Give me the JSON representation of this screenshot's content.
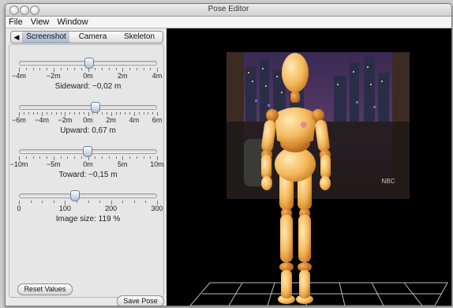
{
  "window": {
    "title": "Pose Editor"
  },
  "menu": {
    "items": [
      "File",
      "View",
      "Window"
    ]
  },
  "tabs": {
    "arrow": "◀",
    "items": [
      "Screenshot",
      "Camera",
      "Skeleton"
    ],
    "selected": "Screenshot"
  },
  "sliders": [
    {
      "ticks": [
        "−4m",
        "−2m",
        "0m",
        "2m",
        "4m"
      ],
      "label": "Sideward: −0,02 m",
      "fraction": 0.5
    },
    {
      "ticks": [
        "−6m",
        "−4m",
        "−2m",
        "0m",
        "2m",
        "4m",
        "6m"
      ],
      "label": "Upward: 0,67 m",
      "fraction": 0.55
    },
    {
      "ticks": [
        "−10m",
        "−5m",
        "0m",
        "5m",
        "10m"
      ],
      "label": "Toward: −0,15 m",
      "fraction": 0.49
    },
    {
      "ticks": [
        "0",
        "100",
        "200",
        "300"
      ],
      "label": "Image size: 119 %",
      "fraction": 0.4
    }
  ],
  "buttons": {
    "reset": "Reset Values",
    "save": "Save Pose"
  },
  "viewport": {
    "watermark": "NBC"
  }
}
